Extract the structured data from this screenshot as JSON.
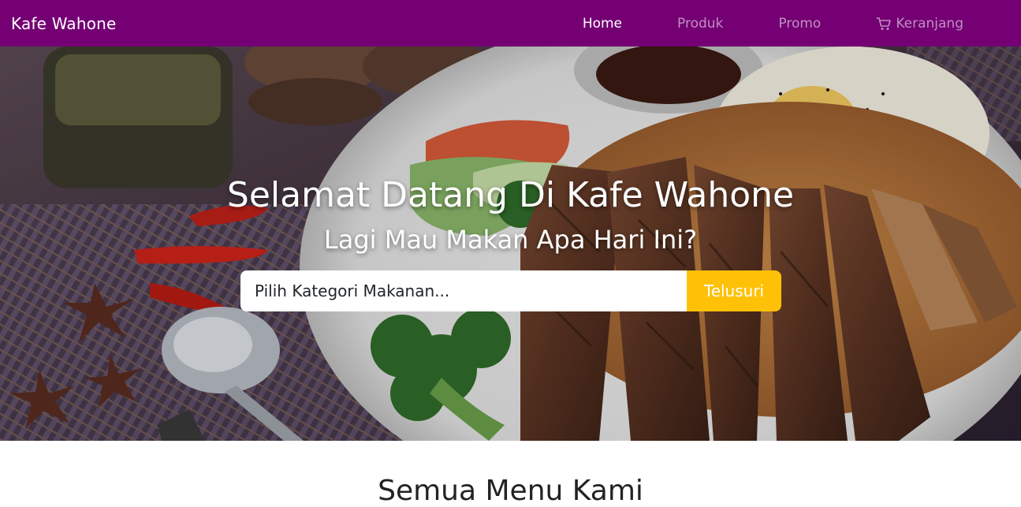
{
  "navbar": {
    "brand": "Kafe Wahone",
    "links": [
      {
        "label": "Home",
        "active": true
      },
      {
        "label": "Produk",
        "active": false
      },
      {
        "label": "Promo",
        "active": false
      },
      {
        "label": "Keranjang",
        "active": false,
        "icon": "cart-icon"
      }
    ]
  },
  "hero": {
    "title": "Selamat Datang Di Kafe Wahone",
    "subtitle": "Lagi Mau Makan Apa Hari Ini?",
    "search": {
      "placeholder": "Pilih Kategori Makanan...",
      "value": "",
      "button_label": "Telusuri"
    }
  },
  "section": {
    "heading": "Semua Menu Kami"
  },
  "colors": {
    "navbar": "#740074",
    "accent": "#ffc107",
    "text_light": "#ffffff"
  }
}
